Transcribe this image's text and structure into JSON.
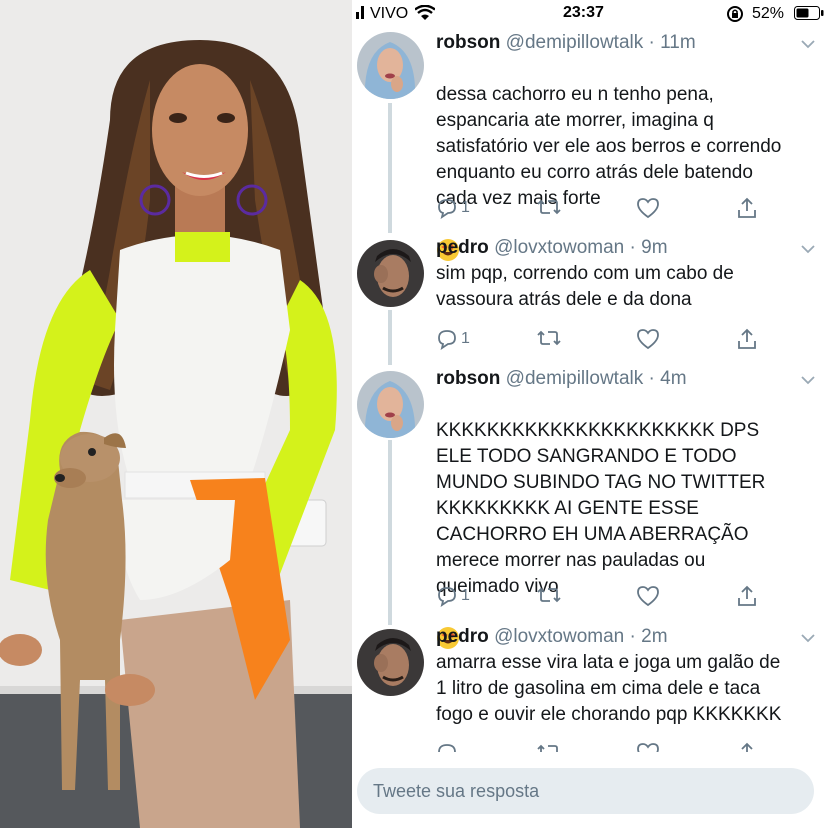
{
  "status_bar": {
    "carrier": "VIVO",
    "time": "23:37",
    "battery": "52%"
  },
  "tweets": [
    {
      "name": "robson",
      "handle": "@demipillowtalk",
      "time": "· 11m",
      "text": "dessa cachorro eu n tenho pena,\nespancaria ate morrer, imagina q\nsatisfatório ver ele aos berros e correndo\nenquanto eu corro atrás dele batendo\ncada vez mais forte",
      "replies": "1",
      "emoji": "star-struck-emoji"
    },
    {
      "name": "pedro",
      "handle": "@lovxtowoman",
      "time": "· 9m",
      "text": "sim pqp, correndo com um cabo de\nvassoura atrás dele e da dona",
      "replies": "1"
    },
    {
      "name": "robson",
      "handle": "@demipillowtalk",
      "time": "· 4m",
      "text": "KKKKKKKKKKKKKKKKKKKKKK DPS\nELE TODO SANGRANDO E TODO\nMUNDO SUBINDO TAG NO TWITTER\nKKKKKKKKK AI GENTE ESSE\nCACHORRO EH UMA ABERRAÇÃO\nmerece morrer nas pauladas ou\nqueimado vivo",
      "replies": "1",
      "emoji": "star-struck-emoji"
    },
    {
      "name": "pedro",
      "handle": "@lovxtowoman",
      "time": "· 2m",
      "text": "amarra esse vira lata e joga um galão de\n1 litro de gasolina em cima dele e taca\nfogo e ouvir ele chorando pqp KKKKKKK",
      "replies": ""
    }
  ],
  "reply_box": {
    "placeholder": "Tweete sua resposta"
  },
  "colors": {
    "text": "#14171a",
    "secondary": "#657786",
    "thread_line": "#cfd9de",
    "reply_box": "#e6ecf0"
  }
}
